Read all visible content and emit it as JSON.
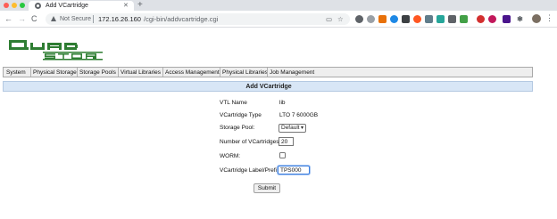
{
  "browser": {
    "tab_title": "Add VCartridge",
    "tab_close": "✕",
    "new_tab": "+",
    "security_label": "Not Secure",
    "url_host": "172.16.26.160",
    "url_path": "/cgi-bin/addvcartridge.cgi",
    "back": "←",
    "forward": "→",
    "reload": "C",
    "menu": "⋮"
  },
  "logo": {
    "line1": "QUAD",
    "line2": "STOR",
    "color": "#2e7d32"
  },
  "menu": {
    "items": [
      "System",
      "Physical Storage",
      "Storage Pools",
      "Virtual Libraries",
      "Access Management",
      "Physical Libraries",
      "Job Management"
    ]
  },
  "page": {
    "title": "Add VCartridge"
  },
  "form": {
    "vtl_name_label": "VTL Name",
    "vtl_name_value": "lib",
    "vcart_type_label": "VCartridge Type",
    "vcart_type_value": "LTO 7 6000GB",
    "storage_pool_label": "Storage Pool:",
    "storage_pool_value": "Default",
    "num_label": "Number of VCartridges",
    "num_value": "20",
    "worm_label": "WORM:",
    "worm_checked": false,
    "prefix_label": "VCartridge Label/Prefix",
    "prefix_value": "TPS000",
    "submit_label": "Submit"
  },
  "colors": {
    "title_band": "#d8e6f6",
    "menubar": "#eeeeee",
    "focus_ring": "#3b7ddd"
  }
}
